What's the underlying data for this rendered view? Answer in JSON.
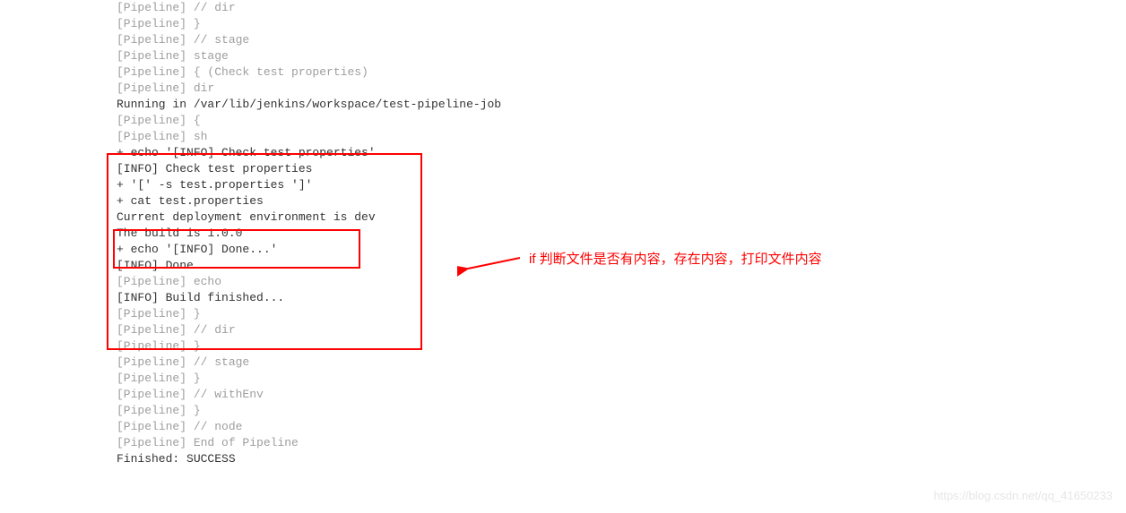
{
  "lines": [
    {
      "cls": "muted",
      "t": "[Pipeline] // dir"
    },
    {
      "cls": "muted",
      "t": "[Pipeline] }"
    },
    {
      "cls": "muted",
      "t": "[Pipeline] // stage"
    },
    {
      "cls": "muted",
      "t": "[Pipeline] stage"
    },
    {
      "cls": "muted",
      "t": "[Pipeline] { (Check test properties)"
    },
    {
      "cls": "muted",
      "t": "[Pipeline] dir"
    },
    {
      "cls": "strong",
      "t": "Running in /var/lib/jenkins/workspace/test-pipeline-job"
    },
    {
      "cls": "muted",
      "t": "[Pipeline] {"
    },
    {
      "cls": "muted",
      "t": "[Pipeline] sh"
    },
    {
      "cls": "strong",
      "t": "+ echo '[INFO] Check test properties'"
    },
    {
      "cls": "strong",
      "t": "[INFO] Check test properties"
    },
    {
      "cls": "strong",
      "t": "+ '[' -s test.properties ']'"
    },
    {
      "cls": "strong",
      "t": "+ cat test.properties"
    },
    {
      "cls": "strong",
      "t": "Current deployment environment is dev"
    },
    {
      "cls": "strong",
      "t": "The build is 1.0.0"
    },
    {
      "cls": "strong",
      "t": "+ echo '[INFO] Done...'"
    },
    {
      "cls": "strong",
      "t": "[INFO] Done..."
    },
    {
      "cls": "muted",
      "t": "[Pipeline] echo"
    },
    {
      "cls": "strong",
      "t": "[INFO] Build finished..."
    },
    {
      "cls": "muted",
      "t": "[Pipeline] }"
    },
    {
      "cls": "muted",
      "t": "[Pipeline] // dir"
    },
    {
      "cls": "muted",
      "t": "[Pipeline] }"
    },
    {
      "cls": "muted",
      "t": "[Pipeline] // stage"
    },
    {
      "cls": "muted",
      "t": "[Pipeline] }"
    },
    {
      "cls": "muted",
      "t": "[Pipeline] // withEnv"
    },
    {
      "cls": "muted",
      "t": "[Pipeline] }"
    },
    {
      "cls": "muted",
      "t": "[Pipeline] // node"
    },
    {
      "cls": "muted",
      "t": "[Pipeline] End of Pipeline"
    },
    {
      "cls": "strong",
      "t": "Finished: SUCCESS"
    }
  ],
  "annotation": "if 判断文件是否有内容，存在内容，打印文件内容",
  "watermark": "https://blog.csdn.net/qq_41650233"
}
